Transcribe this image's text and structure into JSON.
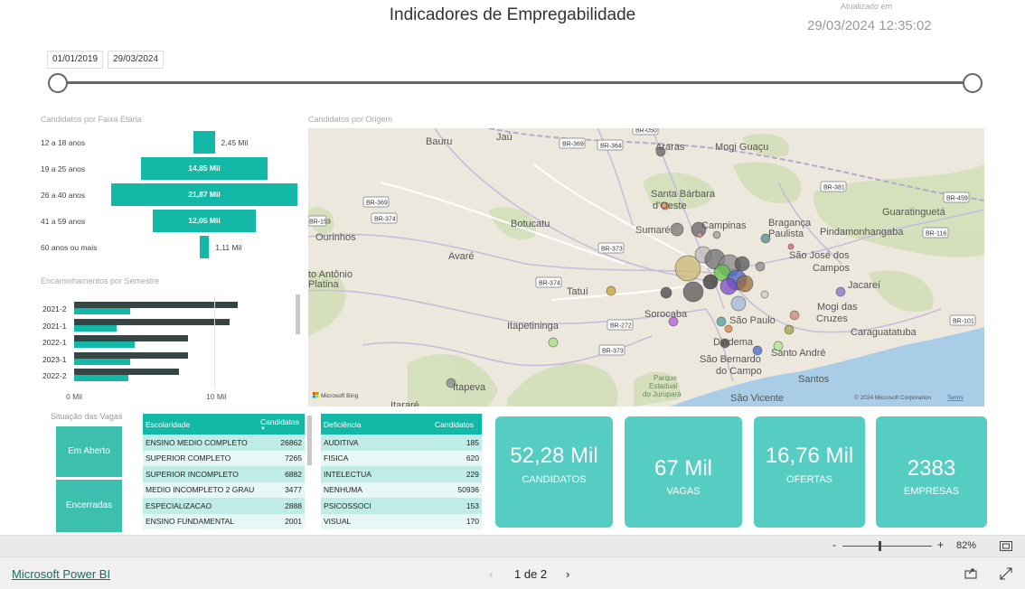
{
  "header": {
    "title": "Indicadores de Empregabilidade",
    "updated_label": "Atualizado em",
    "updated_value": "29/03/2024 12:35:02"
  },
  "date_range": {
    "start": "01/01/2019",
    "end": "29/03/2024"
  },
  "age_chart": {
    "title": "Candidatos por Faixa Etária",
    "rows": [
      {
        "label": "12 a 18 anos",
        "value": 2.45,
        "display": "2,45 Mil"
      },
      {
        "label": "19 a 25 anos",
        "value": 14.85,
        "display": "14,85 Mil"
      },
      {
        "label": "26 a 40 anos",
        "value": 21.87,
        "display": "21,87 Mil"
      },
      {
        "label": "41 a 59 anos",
        "value": 12.05,
        "display": "12,05 Mil"
      },
      {
        "label": "60 anos ou mais",
        "value": 1.11,
        "display": "1,11 Mil"
      }
    ]
  },
  "semester_chart": {
    "title": "Encaminhamentos por Semestre",
    "axis_ticks": [
      "0 Mil",
      "10 Mil"
    ],
    "rows": [
      {
        "label": "2021-2",
        "dark": 11.7,
        "teal": 4.0
      },
      {
        "label": "2021-1",
        "dark": 11.1,
        "teal": 3.0
      },
      {
        "label": "2022-1",
        "dark": 8.1,
        "teal": 4.3
      },
      {
        "label": "2023-1",
        "dark": 8.1,
        "teal": 4.0
      },
      {
        "label": "2022-2",
        "dark": 7.5,
        "teal": 3.9
      }
    ]
  },
  "map": {
    "title": "Candidatos por Origem",
    "attribution": "© 2024 Microsoft Corporation",
    "terms": "Terms",
    "logo": "Microsoft Bing",
    "cities": [
      {
        "name": "Bauru"
      },
      {
        "name": "Jaú"
      },
      {
        "name": "Araras"
      },
      {
        "name": "Mogi Guaçu"
      },
      {
        "name": "Santa Bárbara"
      },
      {
        "name": "d'Oeste"
      },
      {
        "name": "Botucatu"
      },
      {
        "name": "Sumaré"
      },
      {
        "name": "Campinas"
      },
      {
        "name": "Bragança"
      },
      {
        "name": "Paulista"
      },
      {
        "name": "Guaratinguetá"
      },
      {
        "name": "Pindamonhangaba"
      },
      {
        "name": "Ourinhos"
      },
      {
        "name": "Avaré"
      },
      {
        "name": "São José dos"
      },
      {
        "name": "Campos"
      },
      {
        "name": "to Antônio"
      },
      {
        "name": "Platina"
      },
      {
        "name": "Tatuí"
      },
      {
        "name": "Jacareí"
      },
      {
        "name": "Itapetininga"
      },
      {
        "name": "Sorocaba"
      },
      {
        "name": "São Paulo"
      },
      {
        "name": "Mogi das"
      },
      {
        "name": "Cruzes"
      },
      {
        "name": "Caraguatatuba"
      },
      {
        "name": "Diadema"
      },
      {
        "name": "Santo André"
      },
      {
        "name": "São Bernardo"
      },
      {
        "name": "do Campo"
      },
      {
        "name": "Santos"
      },
      {
        "name": "Itapeva"
      },
      {
        "name": "São Vicente"
      },
      {
        "name": "Itararé"
      },
      {
        "name": "Parque"
      },
      {
        "name": "Estadual"
      },
      {
        "name": "do Jurupará"
      }
    ],
    "shields": [
      "BR-369",
      "BR-364",
      "BR-381",
      "BR-459",
      "BR-153",
      "BR-369",
      "BR-374",
      "BR-116",
      "BR-373",
      "BR-374",
      "BR-272",
      "BR-373",
      "BR-101",
      "BR-050"
    ]
  },
  "situation": {
    "title": "Situação das Vagas",
    "buttons": [
      "Em Aberto",
      "Encerradas"
    ]
  },
  "table_escolaridade": {
    "columns": [
      "Escolaridade",
      "Candidatos"
    ],
    "rows": [
      [
        "ENSINO MEDIO COMPLETO",
        "26862"
      ],
      [
        "SUPERIOR COMPLETO",
        "7265"
      ],
      [
        "SUPERIOR INCOMPLETO",
        "6882"
      ],
      [
        "MEDIO INCOMPLETO 2 GRAU",
        "3477"
      ],
      [
        "ESPECIALIZACAO",
        "2888"
      ],
      [
        "ENSINO FUNDAMENTAL",
        "2001"
      ]
    ]
  },
  "table_deficiencia": {
    "columns": [
      "Deficiência",
      "Candidatos"
    ],
    "rows": [
      [
        "AUDITIVA",
        "185"
      ],
      [
        "FISICA",
        "620"
      ],
      [
        "INTELECTUA",
        "229"
      ],
      [
        "NENHUMA",
        "50936"
      ],
      [
        "PSICOSSOCI",
        "153"
      ],
      [
        "VISUAL",
        "170"
      ]
    ]
  },
  "cards": [
    {
      "value": "52,28 Mil",
      "label": "CANDIDATOS"
    },
    {
      "value": "67 Mil",
      "label": "VAGAS"
    },
    {
      "value": "16,76 Mil",
      "label": "OFERTAS"
    },
    {
      "value": "2383",
      "label": "EMPRESAS"
    }
  ],
  "zoom": {
    "minus": "-",
    "plus": "+",
    "level": "82%",
    "fraction": 0.4
  },
  "footer": {
    "brand": "Microsoft Power BI",
    "page_label": "1 de 2"
  },
  "colors": {
    "teal": "#14b8a6",
    "card": "#55cdc2",
    "dark_bar": "#374446"
  }
}
